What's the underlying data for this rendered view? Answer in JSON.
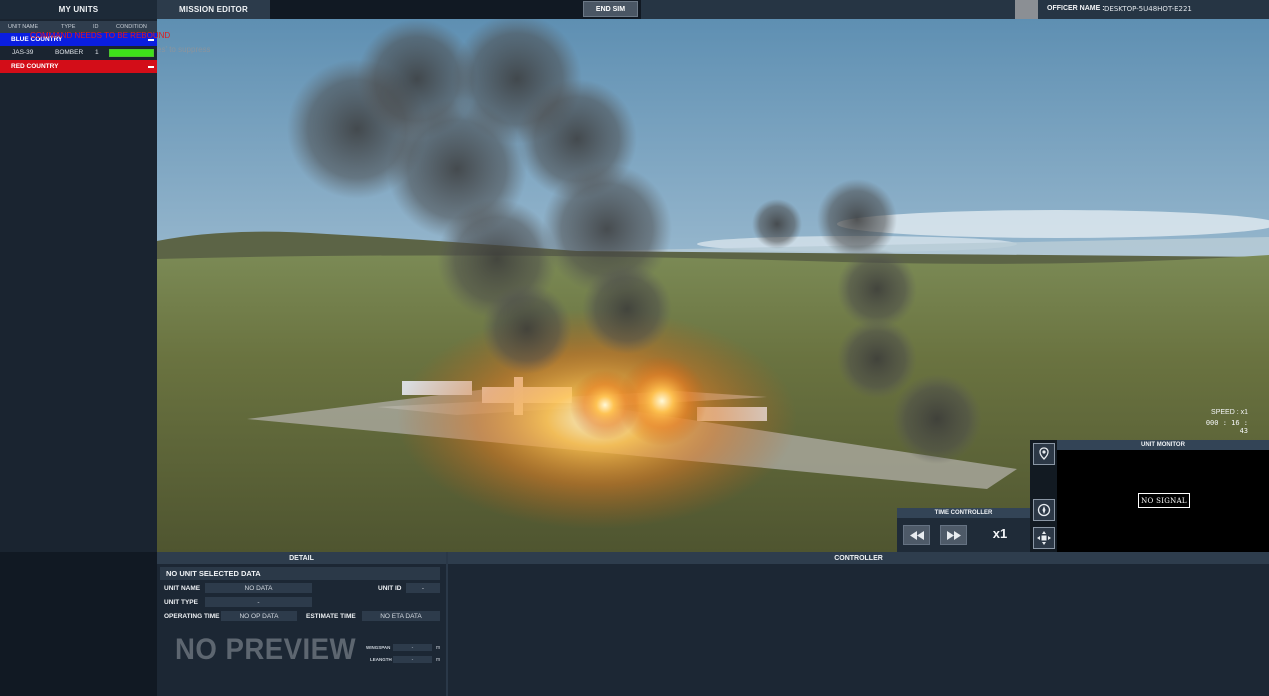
{
  "top_bar": {
    "my_units_tab": "MY UNITS",
    "mission_editor_tab": "MISSION EDITOR",
    "end_sim_button": "END SIM",
    "officer_label": "OFFICER NAME :",
    "officer_name": "DESKTOP-5U48HOT-E221"
  },
  "unit_list": {
    "columns": [
      "UNIT NAME",
      "TYPE",
      "ID",
      "CONDITION"
    ],
    "blue_country": "BLUE COUNTRY",
    "red_country": "RED COUNTRY",
    "units": [
      {
        "name": "JAS-39",
        "type": "BOMBER",
        "id": "1",
        "condition_fraction": 1.0
      }
    ],
    "overlay_warning": "COMMAND NEEDS TO BE REBOUND",
    "overlay_hint": "es' to suppress"
  },
  "viewport": {
    "speed": "SPEED : x1",
    "clock": "000 : 16 : 43"
  },
  "time_controller": {
    "title": "TIME CONTROLLER",
    "multiplier": "x1",
    "rewind_icon": "rewind-icon",
    "fast_forward_icon": "fast-forward-icon"
  },
  "unit_monitor": {
    "title": "UNIT MONITOR",
    "status": "NO SIGNAL",
    "side_icons": [
      "map-pin-icon",
      "compass-icon",
      "fullscreen-icon"
    ]
  },
  "detail": {
    "title": "DETAIL",
    "header": "NO UNIT SELECTED DATA",
    "unit_name_label": "UNIT NAME",
    "unit_name_value": "NO DATA",
    "unit_id_label": "UNIT ID",
    "unit_id_value": "-",
    "unit_type_label": "UNIT TYPE",
    "unit_type_value": "-",
    "operating_time_label": "OPERATING TIME",
    "operating_time_value": "NO OP DATA",
    "estimate_time_label": "ESTIMATE TIME",
    "estimate_time_value": "NO ETA DATA",
    "preview": "NO PREVIEW",
    "wingspan_label": "WINGSPAN",
    "wingspan_value": "-",
    "length_label": "LEANGTH",
    "length_value": "-",
    "unit_m": "m"
  },
  "controller": {
    "title": "CONTROLLER"
  },
  "colors": {
    "blue_country": "#0a1ee0",
    "red_country": "#d30d18",
    "condition_ok": "#3ee11a"
  }
}
